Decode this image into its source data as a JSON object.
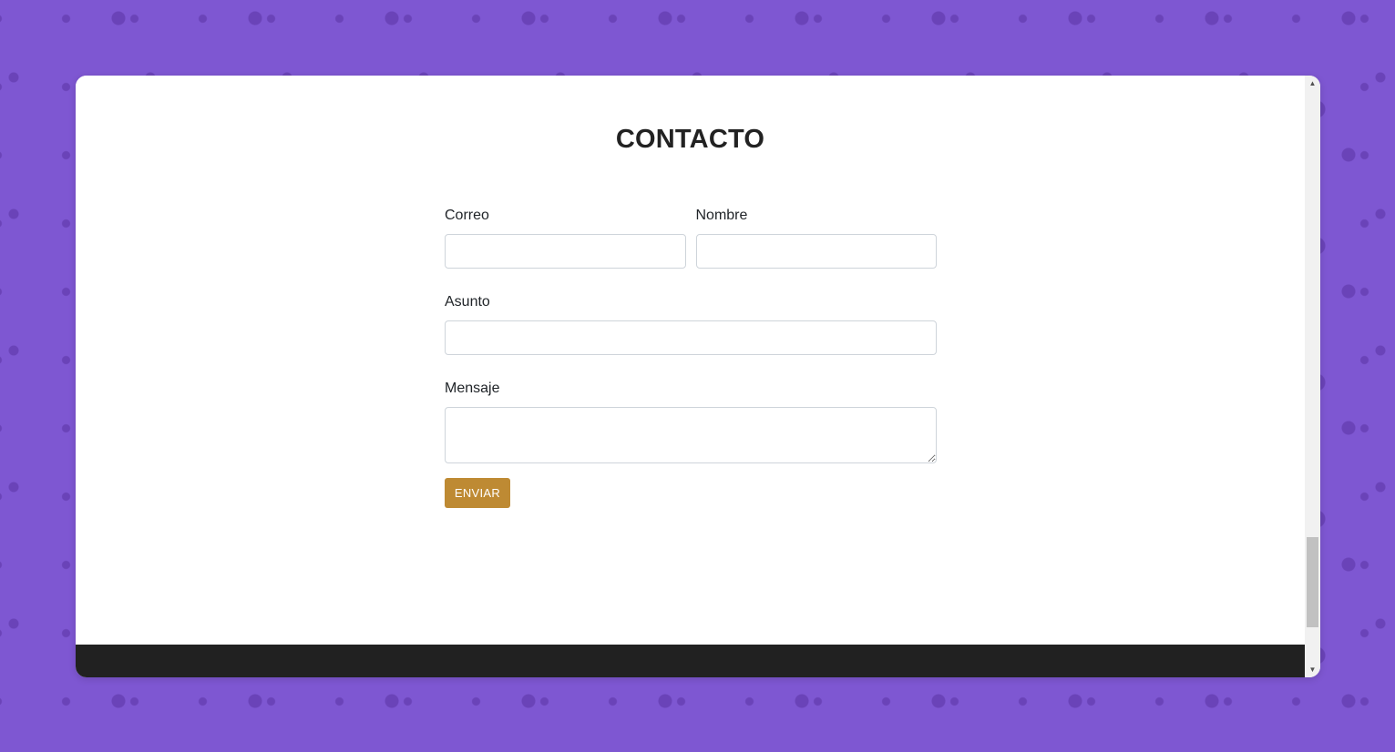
{
  "page": {
    "title": "CONTACTO"
  },
  "form": {
    "email_label": "Correo",
    "name_label": "Nombre",
    "subject_label": "Asunto",
    "message_label": "Mensaje",
    "email_value": "",
    "name_value": "",
    "subject_value": "",
    "message_value": "",
    "submit_label": "ENVIAR"
  },
  "scrollbar": {
    "up_icon": "▲",
    "down_icon": "▼"
  },
  "colors": {
    "background": "#7e57d2",
    "background_dots": "#6a43b8",
    "button": "#be8a33",
    "footer": "#212121",
    "title_text": "#222222"
  },
  "icons": {
    "scroll_up": "arrow-up-icon",
    "scroll_down": "arrow-down-icon"
  }
}
